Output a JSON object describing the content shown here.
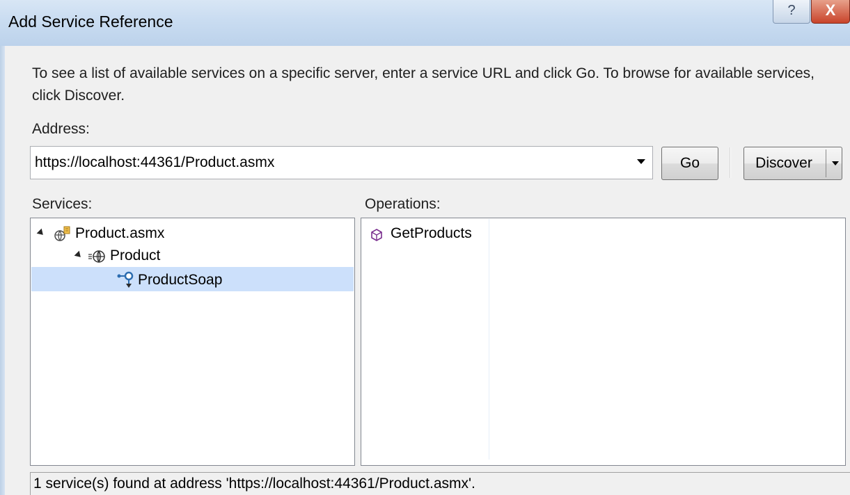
{
  "window": {
    "title": "Add Service Reference",
    "help_glyph": "?",
    "close_glyph": "X"
  },
  "description": "To see a list of available services on a specific server, enter a service URL and click Go. To browse for available services, click Discover.",
  "address": {
    "label": "Address:",
    "value": "https://localhost:44361/Product.asmx"
  },
  "buttons": {
    "go": "Go",
    "discover": "Discover"
  },
  "services": {
    "label": "Services:",
    "tree": [
      {
        "label": "Product.asmx",
        "icon": "web-reference-icon",
        "expanded": true
      },
      {
        "label": "Product",
        "icon": "service-globe-icon",
        "expanded": true
      },
      {
        "label": "ProductSoap",
        "icon": "endpoint-icon",
        "selected": true
      }
    ]
  },
  "operations": {
    "label": "Operations:",
    "items": [
      {
        "label": "GetProducts",
        "icon": "operation-cube-icon"
      }
    ]
  },
  "status": "1 service(s) found at address 'https://localhost:44361/Product.asmx'.",
  "colors": {
    "selection": "#cce0fb",
    "titlebar": "#c9dcf1",
    "close": "#c9432a"
  }
}
